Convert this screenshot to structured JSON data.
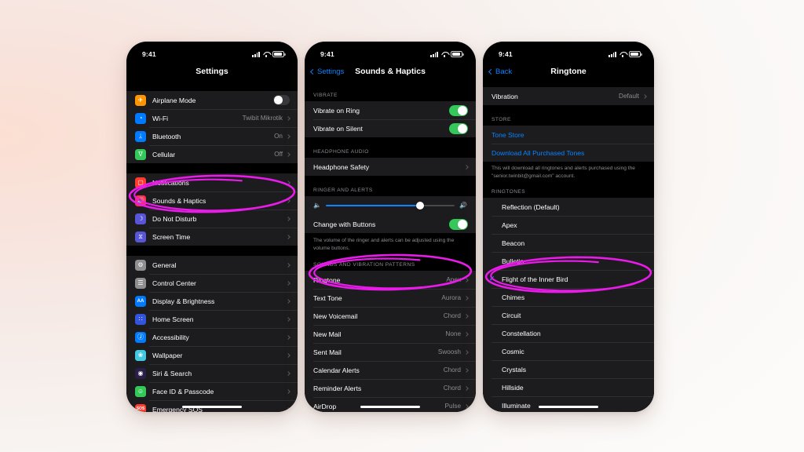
{
  "statusbar": {
    "time": "9:41"
  },
  "phone1": {
    "title": "Settings",
    "groups": [
      {
        "rows": [
          {
            "icon": "airplane-icon",
            "icon_bg": "#ff9500",
            "glyph": "✈",
            "label": "Airplane Mode",
            "control": "toggle-off"
          },
          {
            "icon": "wifi-icon",
            "icon_bg": "#007aff",
            "glyph": "◔",
            "label": "Wi-Fi",
            "value": "Twibit Mikrotik",
            "control": "chevron"
          },
          {
            "icon": "bluetooth-icon",
            "icon_bg": "#007aff",
            "glyph": "ᛦ",
            "label": "Bluetooth",
            "value": "On",
            "control": "chevron"
          },
          {
            "icon": "cellular-icon",
            "icon_bg": "#34c759",
            "glyph": "ᐁ",
            "label": "Cellular",
            "value": "Off",
            "control": "chevron"
          }
        ]
      },
      {
        "rows": [
          {
            "icon": "notifications-icon",
            "icon_bg": "#ff3b30",
            "glyph": "▢",
            "label": "Notifications",
            "control": "chevron"
          },
          {
            "icon": "sounds-haptics-icon",
            "icon_bg": "#ff2d55",
            "glyph": "🔊",
            "label": "Sounds & Haptics",
            "control": "chevron"
          },
          {
            "icon": "do-not-disturb-icon",
            "icon_bg": "#5856d6",
            "glyph": "☽",
            "label": "Do Not Disturb",
            "control": "chevron"
          },
          {
            "icon": "screen-time-icon",
            "icon_bg": "#5856d6",
            "glyph": "⧖",
            "label": "Screen Time",
            "control": "chevron"
          }
        ]
      },
      {
        "rows": [
          {
            "icon": "general-icon",
            "icon_bg": "#8e8e93",
            "glyph": "⚙",
            "label": "General",
            "control": "chevron"
          },
          {
            "icon": "control-center-icon",
            "icon_bg": "#8e8e93",
            "glyph": "☰",
            "label": "Control Center",
            "control": "chevron"
          },
          {
            "icon": "display-brightness-icon",
            "icon_bg": "#007aff",
            "glyph": "AA",
            "label": "Display & Brightness",
            "control": "chevron"
          },
          {
            "icon": "home-screen-icon",
            "icon_bg": "#3355dd",
            "glyph": "∷",
            "label": "Home Screen",
            "control": "chevron"
          },
          {
            "icon": "accessibility-icon",
            "icon_bg": "#007aff",
            "glyph": "Ⓙ",
            "label": "Accessibility",
            "control": "chevron"
          },
          {
            "icon": "wallpaper-icon",
            "icon_bg": "#41c8e0",
            "glyph": "❀",
            "label": "Wallpaper",
            "control": "chevron"
          },
          {
            "icon": "siri-search-icon",
            "icon_bg": "#2b1f4a",
            "glyph": "◉",
            "label": "Siri & Search",
            "control": "chevron"
          },
          {
            "icon": "face-id-passcode-icon",
            "icon_bg": "#34c759",
            "glyph": "☺",
            "label": "Face ID & Passcode",
            "control": "chevron"
          },
          {
            "icon": "emergency-sos-icon",
            "icon_bg": "#ff3b30",
            "glyph": "SOS",
            "label": "Emergency SOS",
            "control": "chevron"
          }
        ]
      }
    ]
  },
  "phone2": {
    "back_label": "Settings",
    "title": "Sounds & Haptics",
    "section_vibrate": "VIBRATE",
    "vibrate_rows": [
      {
        "label": "Vibrate on Ring",
        "control": "toggle-on"
      },
      {
        "label": "Vibrate on Silent",
        "control": "toggle-on"
      }
    ],
    "section_headphone": "HEADPHONE AUDIO",
    "headphone_rows": [
      {
        "label": "Headphone Safety",
        "control": "chevron"
      }
    ],
    "section_ringer": "RINGER AND ALERTS",
    "slider": {
      "value_percent": 73,
      "low_icon": "speaker-low-icon",
      "high_icon": "speaker-high-icon"
    },
    "change_with_buttons": {
      "label": "Change with Buttons",
      "control": "toggle-on"
    },
    "footnote": "The volume of the ringer and alerts can be adjusted using the volume buttons.",
    "section_patterns": "SOUNDS AND VIBRATION PATTERNS",
    "pattern_rows": [
      {
        "label": "Ringtone",
        "value": "Apex"
      },
      {
        "label": "Text Tone",
        "value": "Aurora"
      },
      {
        "label": "New Voicemail",
        "value": "Chord"
      },
      {
        "label": "New Mail",
        "value": "None"
      },
      {
        "label": "Sent Mail",
        "value": "Swoosh"
      },
      {
        "label": "Calendar Alerts",
        "value": "Chord"
      },
      {
        "label": "Reminder Alerts",
        "value": "Chord"
      },
      {
        "label": "AirDrop",
        "value": "Pulse"
      }
    ]
  },
  "phone3": {
    "back_label": "Back",
    "title": "Ringtone",
    "vibration_row": {
      "label": "Vibration",
      "value": "Default"
    },
    "section_store": "STORE",
    "store_rows": [
      {
        "label": "Tone Store"
      },
      {
        "label": "Download All Purchased Tones"
      }
    ],
    "store_footnote": "This will download all ringtones and alerts purchased using the \"senior.twinbit@gmail.com\" account.",
    "section_ringtones": "RINGTONES",
    "ringtones": [
      {
        "label": "Reflection (Default)",
        "selected": false
      },
      {
        "label": "Apex",
        "selected": false
      },
      {
        "label": "Beacon",
        "selected": false
      },
      {
        "label": "Bulletin",
        "selected": false
      },
      {
        "label": "Flight of the Inner Bird",
        "selected": true
      },
      {
        "label": "Chimes",
        "selected": false
      },
      {
        "label": "Circuit",
        "selected": false
      },
      {
        "label": "Constellation",
        "selected": false
      },
      {
        "label": "Cosmic",
        "selected": false
      },
      {
        "label": "Crystals",
        "selected": false
      },
      {
        "label": "Hillside",
        "selected": false
      },
      {
        "label": "Illuminate",
        "selected": false
      }
    ]
  },
  "annotations": {
    "color": "#e81be8",
    "items": [
      {
        "name": "highlight-sounds-haptics",
        "target": "Sounds & Haptics"
      },
      {
        "name": "highlight-ringtone-row",
        "target": "Ringtone"
      },
      {
        "name": "highlight-flight-of-the-inner-bird",
        "target": "Flight of the Inner Bird"
      }
    ]
  }
}
